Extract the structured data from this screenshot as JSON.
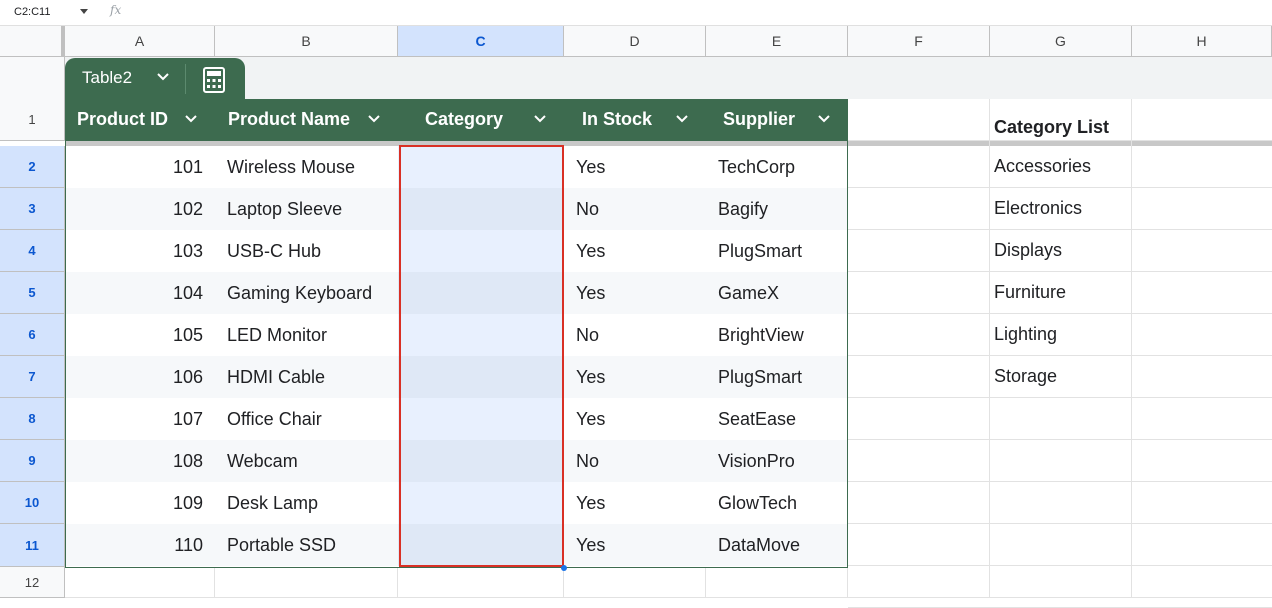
{
  "formula_bar": {
    "name_box": "C2:C11",
    "fx_label": "fx"
  },
  "columns": [
    "A",
    "B",
    "C",
    "D",
    "E",
    "F",
    "G",
    "H"
  ],
  "selected_column": "C",
  "rows": [
    "1",
    "2",
    "3",
    "4",
    "5",
    "6",
    "7",
    "8",
    "9",
    "10",
    "11",
    "12"
  ],
  "table": {
    "name": "Table2",
    "headers": [
      "Product ID",
      "Product Name",
      "Category",
      "In Stock",
      "Supplier"
    ],
    "rows": [
      {
        "id": "101",
        "name": "Wireless Mouse",
        "category": "",
        "stock": "Yes",
        "supplier": "TechCorp"
      },
      {
        "id": "102",
        "name": "Laptop Sleeve",
        "category": "",
        "stock": "No",
        "supplier": "Bagify"
      },
      {
        "id": "103",
        "name": "USB-C Hub",
        "category": "",
        "stock": "Yes",
        "supplier": "PlugSmart"
      },
      {
        "id": "104",
        "name": "Gaming Keyboard",
        "category": "",
        "stock": "Yes",
        "supplier": "GameX"
      },
      {
        "id": "105",
        "name": "LED Monitor",
        "category": "",
        "stock": "No",
        "supplier": "BrightView"
      },
      {
        "id": "106",
        "name": "HDMI Cable",
        "category": "",
        "stock": "Yes",
        "supplier": "PlugSmart"
      },
      {
        "id": "107",
        "name": "Office Chair",
        "category": "",
        "stock": "Yes",
        "supplier": "SeatEase"
      },
      {
        "id": "108",
        "name": "Webcam",
        "category": "",
        "stock": "No",
        "supplier": "VisionPro"
      },
      {
        "id": "109",
        "name": "Desk Lamp",
        "category": "",
        "stock": "Yes",
        "supplier": "GlowTech"
      },
      {
        "id": "110",
        "name": "Portable SSD",
        "category": "",
        "stock": "Yes",
        "supplier": "DataMove"
      }
    ]
  },
  "category_list": {
    "title": "Category List",
    "items": [
      "Accessories",
      "Electronics",
      "Displays",
      "Furniture",
      "Lighting",
      "Storage"
    ]
  },
  "colors": {
    "table_header": "#3d6b4f",
    "selection_border": "#d93025",
    "selection_fill": "#e8f0fe",
    "header_selected": "#d3e3fd"
  }
}
